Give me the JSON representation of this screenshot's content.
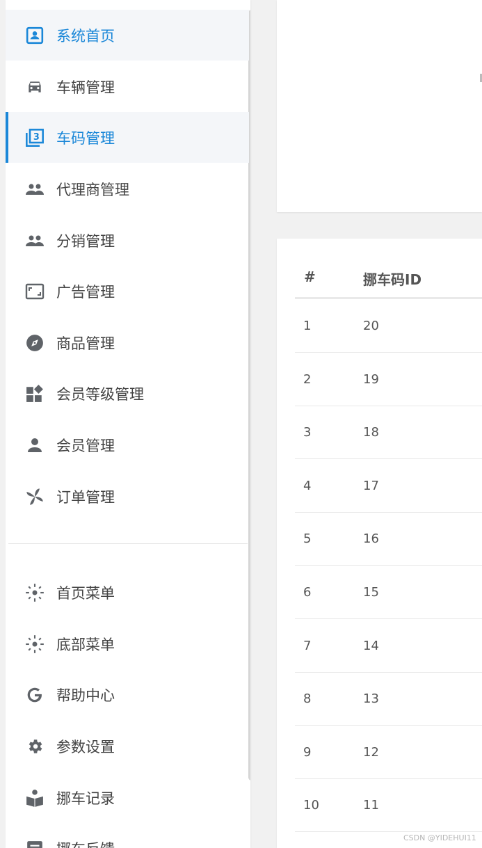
{
  "sidebar": {
    "items": [
      {
        "label": "系统首页",
        "icon": "home-icon"
      },
      {
        "label": "车辆管理",
        "icon": "car-icon"
      },
      {
        "label": "车码管理",
        "icon": "filter-3-icon"
      },
      {
        "label": "代理商管理",
        "icon": "people-icon"
      },
      {
        "label": "分销管理",
        "icon": "people-icon"
      },
      {
        "label": "广告管理",
        "icon": "aspect-ratio-icon"
      },
      {
        "label": "商品管理",
        "icon": "compass-icon"
      },
      {
        "label": "会员等级管理",
        "icon": "widgets-icon"
      },
      {
        "label": "会员管理",
        "icon": "person-icon"
      },
      {
        "label": "订单管理",
        "icon": "pinwheel-icon"
      },
      {
        "label": "首页菜单",
        "icon": "sun-icon"
      },
      {
        "label": "底部菜单",
        "icon": "sun-icon"
      },
      {
        "label": "帮助中心",
        "icon": "google-g-icon"
      },
      {
        "label": "参数设置",
        "icon": "gear-icon"
      },
      {
        "label": "挪车记录",
        "icon": "reader-icon"
      },
      {
        "label": "挪车反馈",
        "icon": "feedback-icon"
      }
    ]
  },
  "table": {
    "headers": [
      "#",
      "挪车码ID"
    ],
    "rows": [
      [
        "1",
        "20"
      ],
      [
        "2",
        "19"
      ],
      [
        "3",
        "18"
      ],
      [
        "4",
        "17"
      ],
      [
        "5",
        "16"
      ],
      [
        "6",
        "15"
      ],
      [
        "7",
        "14"
      ],
      [
        "8",
        "13"
      ],
      [
        "9",
        "12"
      ],
      [
        "10",
        "11"
      ]
    ]
  },
  "watermark": "CSDN @YIDEHUI11",
  "colors": {
    "accent": "#1a87d8",
    "icon": "#5f6368"
  }
}
